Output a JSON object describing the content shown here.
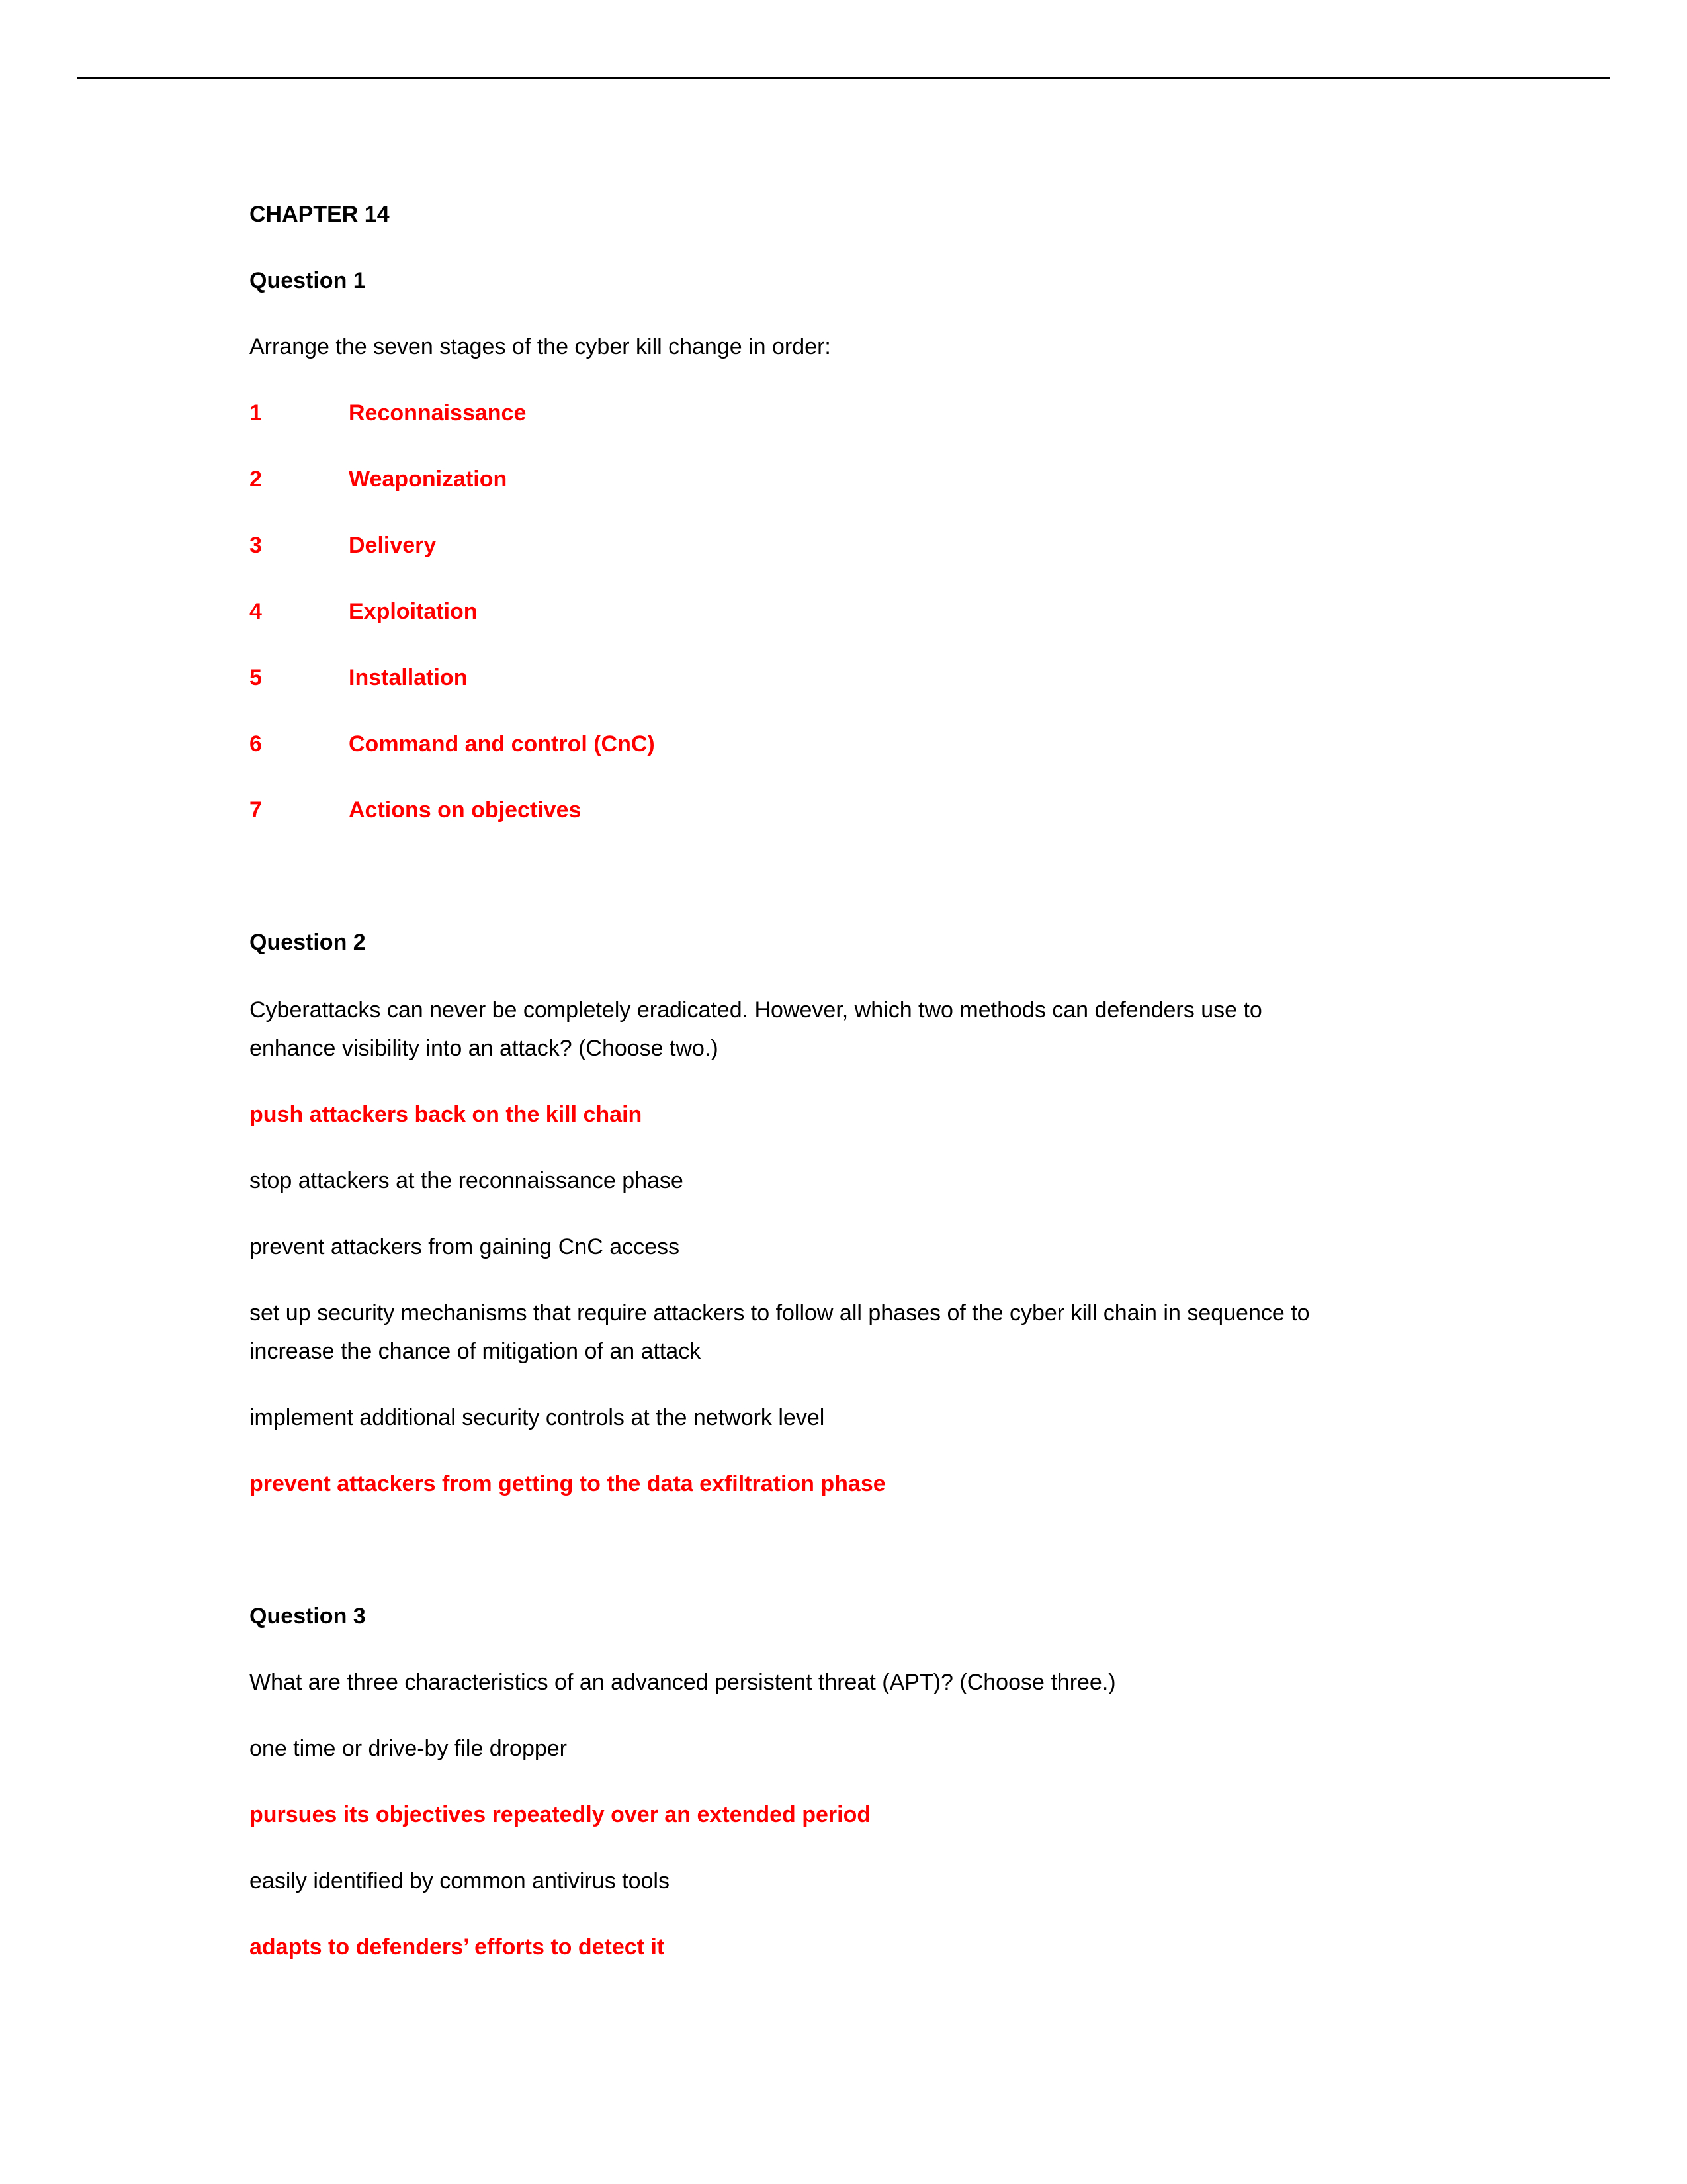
{
  "document": {
    "chapter_title": "CHAPTER 14",
    "answer_color": "#ff0000",
    "questions": [
      {
        "heading": "Question 1",
        "prompt_lines": [
          "Arrange the seven stages of the cyber kill change in order:"
        ],
        "stages": [
          {
            "number": "1",
            "label": "Reconnaissance"
          },
          {
            "number": "2",
            "label": "Weaponization"
          },
          {
            "number": "3",
            "label": "Delivery"
          },
          {
            "number": "4",
            "label": "Exploitation"
          },
          {
            "number": "5",
            "label": "Installation"
          },
          {
            "number": "6",
            "label": "Command and control (CnC)"
          },
          {
            "number": "7",
            "label": "Actions on objectives"
          }
        ]
      },
      {
        "heading": "Question 2",
        "prompt_lines": [
          "Cyberattacks can never be completely eradicated. However, which two methods can defenders use to",
          "enhance visibility into an attack? (Choose two.)"
        ],
        "options": [
          {
            "lines": [
              "push attackers back on the kill chain"
            ],
            "correct": true
          },
          {
            "lines": [
              "stop attackers at the reconnaissance phase"
            ],
            "correct": false
          },
          {
            "lines": [
              "prevent attackers from gaining CnC access"
            ],
            "correct": false
          },
          {
            "lines": [
              "set up security mechanisms that require attackers to follow all phases of the cyber kill chain in sequence to",
              "increase the chance of mitigation of an attack"
            ],
            "correct": false
          },
          {
            "lines": [
              "implement additional security controls at the network level"
            ],
            "correct": false
          },
          {
            "lines": [
              "prevent attackers from getting to the data exfiltration phase"
            ],
            "correct": true
          }
        ]
      },
      {
        "heading": "Question 3",
        "prompt_lines": [
          "What are three characteristics of an advanced persistent threat (APT)? (Choose three.)"
        ],
        "options": [
          {
            "lines": [
              "one time or drive-by file dropper"
            ],
            "correct": false
          },
          {
            "lines": [
              "pursues its objectives repeatedly over an extended period"
            ],
            "correct": true
          },
          {
            "lines": [
              "easily identified by common antivirus tools"
            ],
            "correct": false
          },
          {
            "lines": [
              "adapts to defenders’ efforts to detect it"
            ],
            "correct": true
          }
        ]
      }
    ]
  }
}
